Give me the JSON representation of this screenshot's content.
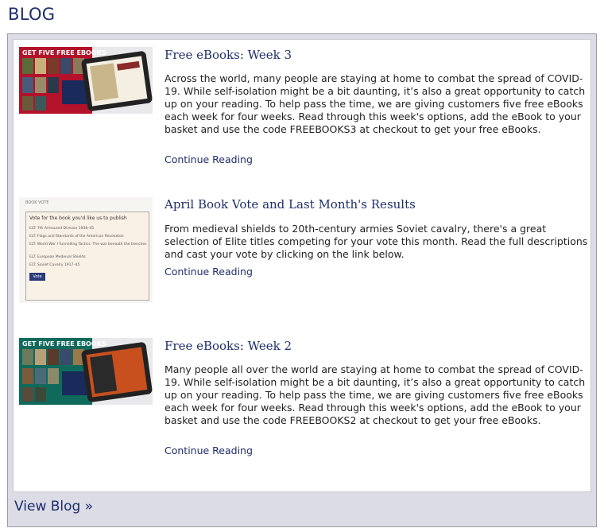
{
  "header": {
    "title": "BLOG"
  },
  "posts": [
    {
      "title": "Free eBooks: Week 3",
      "excerpt": "Across the world, many people are staying at home to combat the spread of COVID-19. While self-isolation might be a bit daunting, it’s also a great opportunity to catch up on your reading. To help pass the time, we are giving customers five free eBooks each week for four weeks. Read through this week's options, add the eBook to your basket and use the code FREEBOOKS3 at checkout to get your free eBooks.",
      "continue_label": "Continue Reading",
      "thumb_banner": "GET FIVE FREE EBOOKS"
    },
    {
      "title": "April Book Vote and Last Month's Results",
      "excerpt": "From medieval shields to 20th-century armies Soviet cavalry, there's a great selection of Elite titles competing for your vote this month. Read the full descriptions and cast your vote by clicking on the link below.",
      "continue_label": "Continue Reading",
      "thumb_label": "BOOK VOTE",
      "thumb_question": "Vote for the book you'd like us to publish",
      "thumb_options": [
        "ELT: 7th Armoured Division 1938–45",
        "ELT: Flags and Standards of the American Revolution",
        "ELT: World War I Tunnelling Tactics: The war beneath the trenches",
        "ELT: European Medieval Shields",
        "ELT: Soviet Cavalry 1917–45"
      ],
      "thumb_button": "Vote"
    },
    {
      "title": "Free eBooks: Week 2",
      "excerpt": "Many people all over the world are staying at home to combat the spread of COVID-19. While self-isolation might be a bit daunting, it’s also a great opportunity to catch up on your reading. To help pass the time, we are giving customers five free eBooks each week for four weeks. Read through this week's options, add the eBook to your basket and use the code FREEBOOKS2 at checkout to get your free eBooks.",
      "continue_label": "Continue Reading",
      "thumb_banner": "GET FIVE FREE EBOOKS"
    }
  ],
  "footer": {
    "view_blog_label": "View Blog »"
  },
  "colors": {
    "link": "#1e2e6e",
    "panel_bg": "#dcdce6",
    "week3_banner": "#b3122a",
    "week2_banner": "#0f6a5c"
  }
}
